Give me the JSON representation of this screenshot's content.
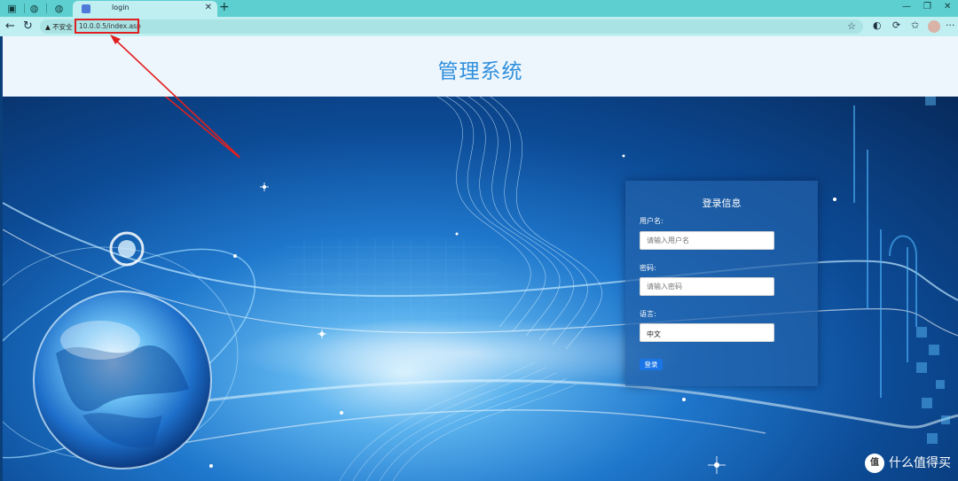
{
  "browser": {
    "tab_title": "login",
    "insecure_label": "不安全",
    "url": "10.0.0.5/index.asp"
  },
  "page": {
    "header_title": "管理系统"
  },
  "login": {
    "title": "登录信息",
    "username_label": "用户名:",
    "username_placeholder": "请输入用户名",
    "password_label": "密码:",
    "password_placeholder": "请输入密码",
    "language_label": "语言:",
    "language_value": "中文",
    "submit_label": "登录"
  },
  "watermark": {
    "badge": "值",
    "text": "什么值得买"
  },
  "colors": {
    "tabbar": "#5ecfd0",
    "header_title": "#2f8fdc",
    "annotation": "#e02020",
    "button": "#1a75e6"
  }
}
